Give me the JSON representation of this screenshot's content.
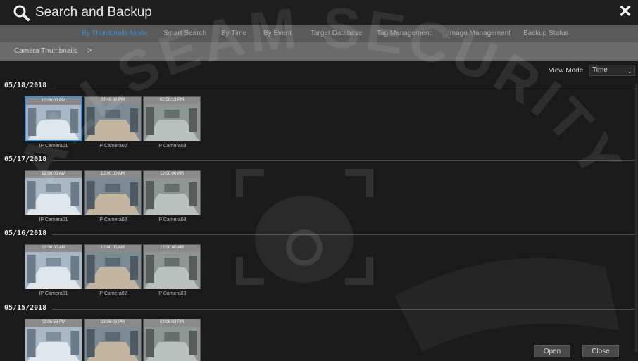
{
  "window": {
    "title": "Search and Backup",
    "title_icon": "search-icon",
    "close_icon": "close-icon"
  },
  "tabs": [
    {
      "label": "By Thumbnails Mode",
      "active": true
    },
    {
      "label": "Smart Search",
      "active": false
    },
    {
      "label": "By Time",
      "active": false
    },
    {
      "label": "By Event",
      "active": false
    },
    {
      "label": "Target Database",
      "active": false
    },
    {
      "label": "Tag Management",
      "active": false
    },
    {
      "label": "Image Management",
      "active": false
    },
    {
      "label": "Backup Status",
      "active": false
    }
  ],
  "breadcrumb": {
    "label": "Camera Thumbnails",
    "separator": ">"
  },
  "view_mode": {
    "label": "View Mode",
    "value": "Time"
  },
  "groups": [
    {
      "date": "05/18/2018",
      "thumbs": [
        {
          "time": "12:00:00 PM",
          "camera": "IP Camera01",
          "selected": true
        },
        {
          "time": "02:40:02 PM",
          "camera": "IP Camera02",
          "selected": false
        },
        {
          "time": "02:50:13 PM",
          "camera": "IP Camera03",
          "selected": false
        }
      ]
    },
    {
      "date": "05/17/2018",
      "thumbs": [
        {
          "time": "12:00:00 AM",
          "camera": "IP Camera01",
          "selected": false
        },
        {
          "time": "12:00:00 AM",
          "camera": "IP Camera02",
          "selected": false
        },
        {
          "time": "12:00:00 AM",
          "camera": "IP Camera03",
          "selected": false
        }
      ]
    },
    {
      "date": "05/16/2018",
      "thumbs": [
        {
          "time": "12:00:00 AM",
          "camera": "IP Camera01",
          "selected": false
        },
        {
          "time": "12:00:00 AM",
          "camera": "IP Camera02",
          "selected": false
        },
        {
          "time": "12:00:00 AM",
          "camera": "IP Camera03",
          "selected": false
        }
      ]
    },
    {
      "date": "05/15/2018",
      "thumbs": [
        {
          "time": "02:05:58 PM",
          "camera": "",
          "selected": false
        },
        {
          "time": "02:06:03 PM",
          "camera": "",
          "selected": false
        },
        {
          "time": "02:06:03 PM",
          "camera": "",
          "selected": false
        }
      ]
    }
  ],
  "buttons": {
    "open": "Open",
    "close": "Close"
  },
  "watermark": {
    "text": "ALLSEAM SECURITY"
  },
  "colors": {
    "accent": "#3c8ed6",
    "tab_bar": "#5a5a5a",
    "crumb_bar": "#6b6b6b",
    "background": "#1a1a1a"
  }
}
